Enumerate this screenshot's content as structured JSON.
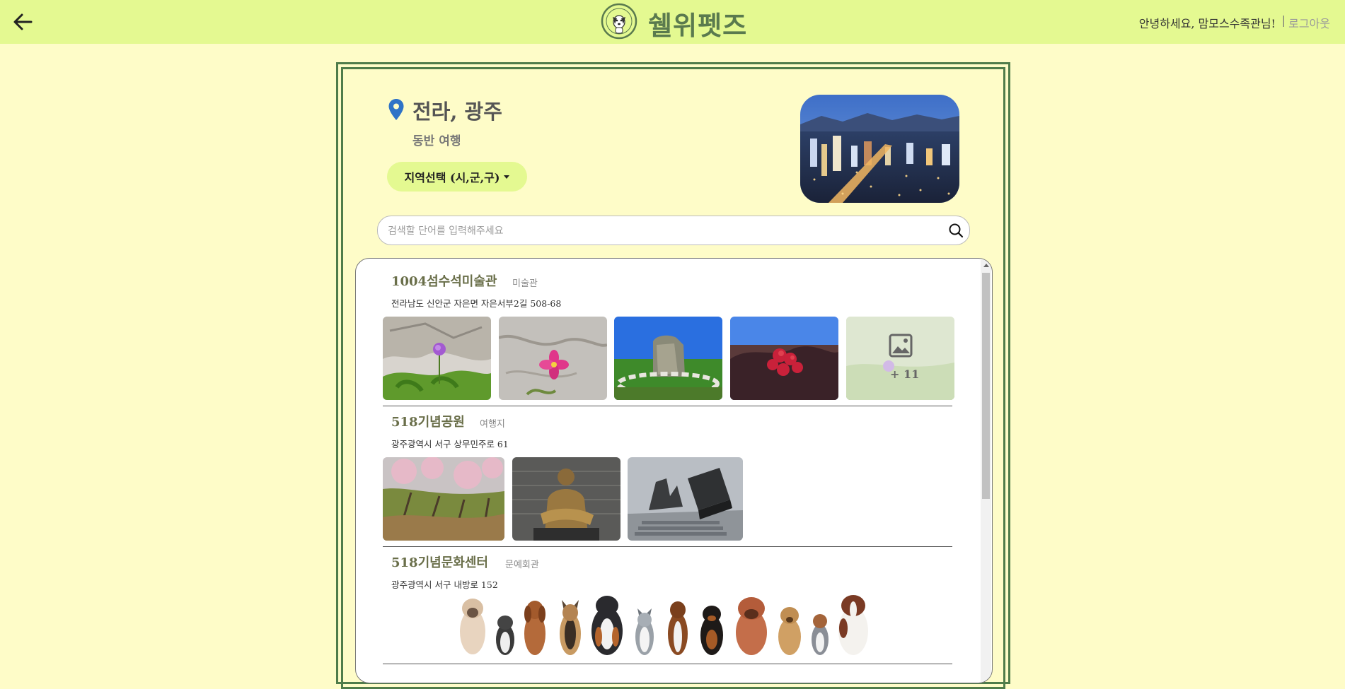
{
  "header": {
    "brand": "쉘위펫즈",
    "greeting": "안녕하세요, 맘모스수족관님!",
    "separator": "|",
    "logout": "로그아웃"
  },
  "region": {
    "title": "전라, 광주",
    "subtitle": "동반 여행",
    "dropdown_label": "지역선택 (시,군,구)"
  },
  "search": {
    "placeholder": "검색할 단어를 입력해주세요",
    "value": ""
  },
  "places": [
    {
      "name": "1004섬수석미술관",
      "category": "미술관",
      "address": "전라남도 신안군 자은면 자은서부2길 508-68",
      "more_count": "+ 11"
    },
    {
      "name": "518기념공원",
      "category": "여행지",
      "address": "광주광역시 서구 상무민주로 61"
    },
    {
      "name": "518기념문화센터",
      "category": "문예회관",
      "address": "광주광역시 서구 내방로 152"
    }
  ],
  "colors": {
    "header_bg": "#e4f991",
    "page_bg": "#fefcc8",
    "frame_border": "#4f7c4a",
    "brand_text": "#5a7a4e"
  }
}
